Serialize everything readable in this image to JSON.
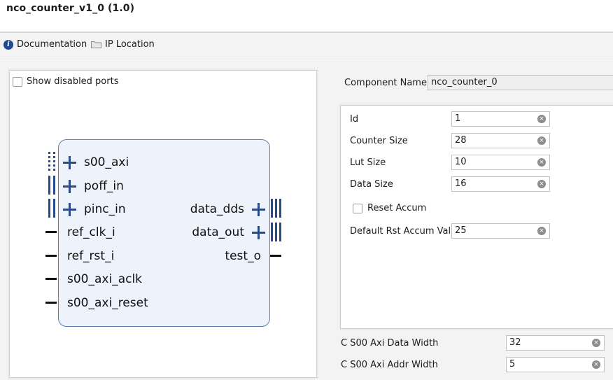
{
  "window": {
    "title": "nco_counter_v1_0 (1.0)"
  },
  "toolbar": {
    "documentation_label": "Documentation",
    "documentation_icon": "info-icon",
    "ip_location_label": "IP Location",
    "ip_location_icon": "folder-icon"
  },
  "diagram": {
    "show_disabled_label": "Show disabled ports",
    "left_ports": [
      "s00_axi",
      "poff_in",
      "pinc_in",
      "ref_clk_i",
      "ref_rst_i",
      "s00_axi_aclk",
      "s00_axi_reset"
    ],
    "right_ports": [
      "data_dds",
      "data_out",
      "test_o"
    ]
  },
  "component": {
    "label": "Component Name",
    "value": "nco_counter_0"
  },
  "params": {
    "id": {
      "label": "Id",
      "value": "1"
    },
    "counter_size": {
      "label": "Counter Size",
      "value": "28"
    },
    "lut_size": {
      "label": "Lut Size",
      "value": "10"
    },
    "data_size": {
      "label": "Data Size",
      "value": "16"
    },
    "reset_accum": {
      "label": "Reset Accum"
    },
    "default_rst": {
      "label": "Default Rst Accum Val",
      "value": "25"
    }
  },
  "axi": {
    "data_width": {
      "label": "C S00 Axi Data Width",
      "value": "32"
    },
    "addr_width": {
      "label": "C S00 Axi Addr Width",
      "value": "5"
    }
  },
  "colors": {
    "accent": "#2a4c86",
    "block_fill": "#eef3fb",
    "block_border": "#5f7fb3"
  }
}
